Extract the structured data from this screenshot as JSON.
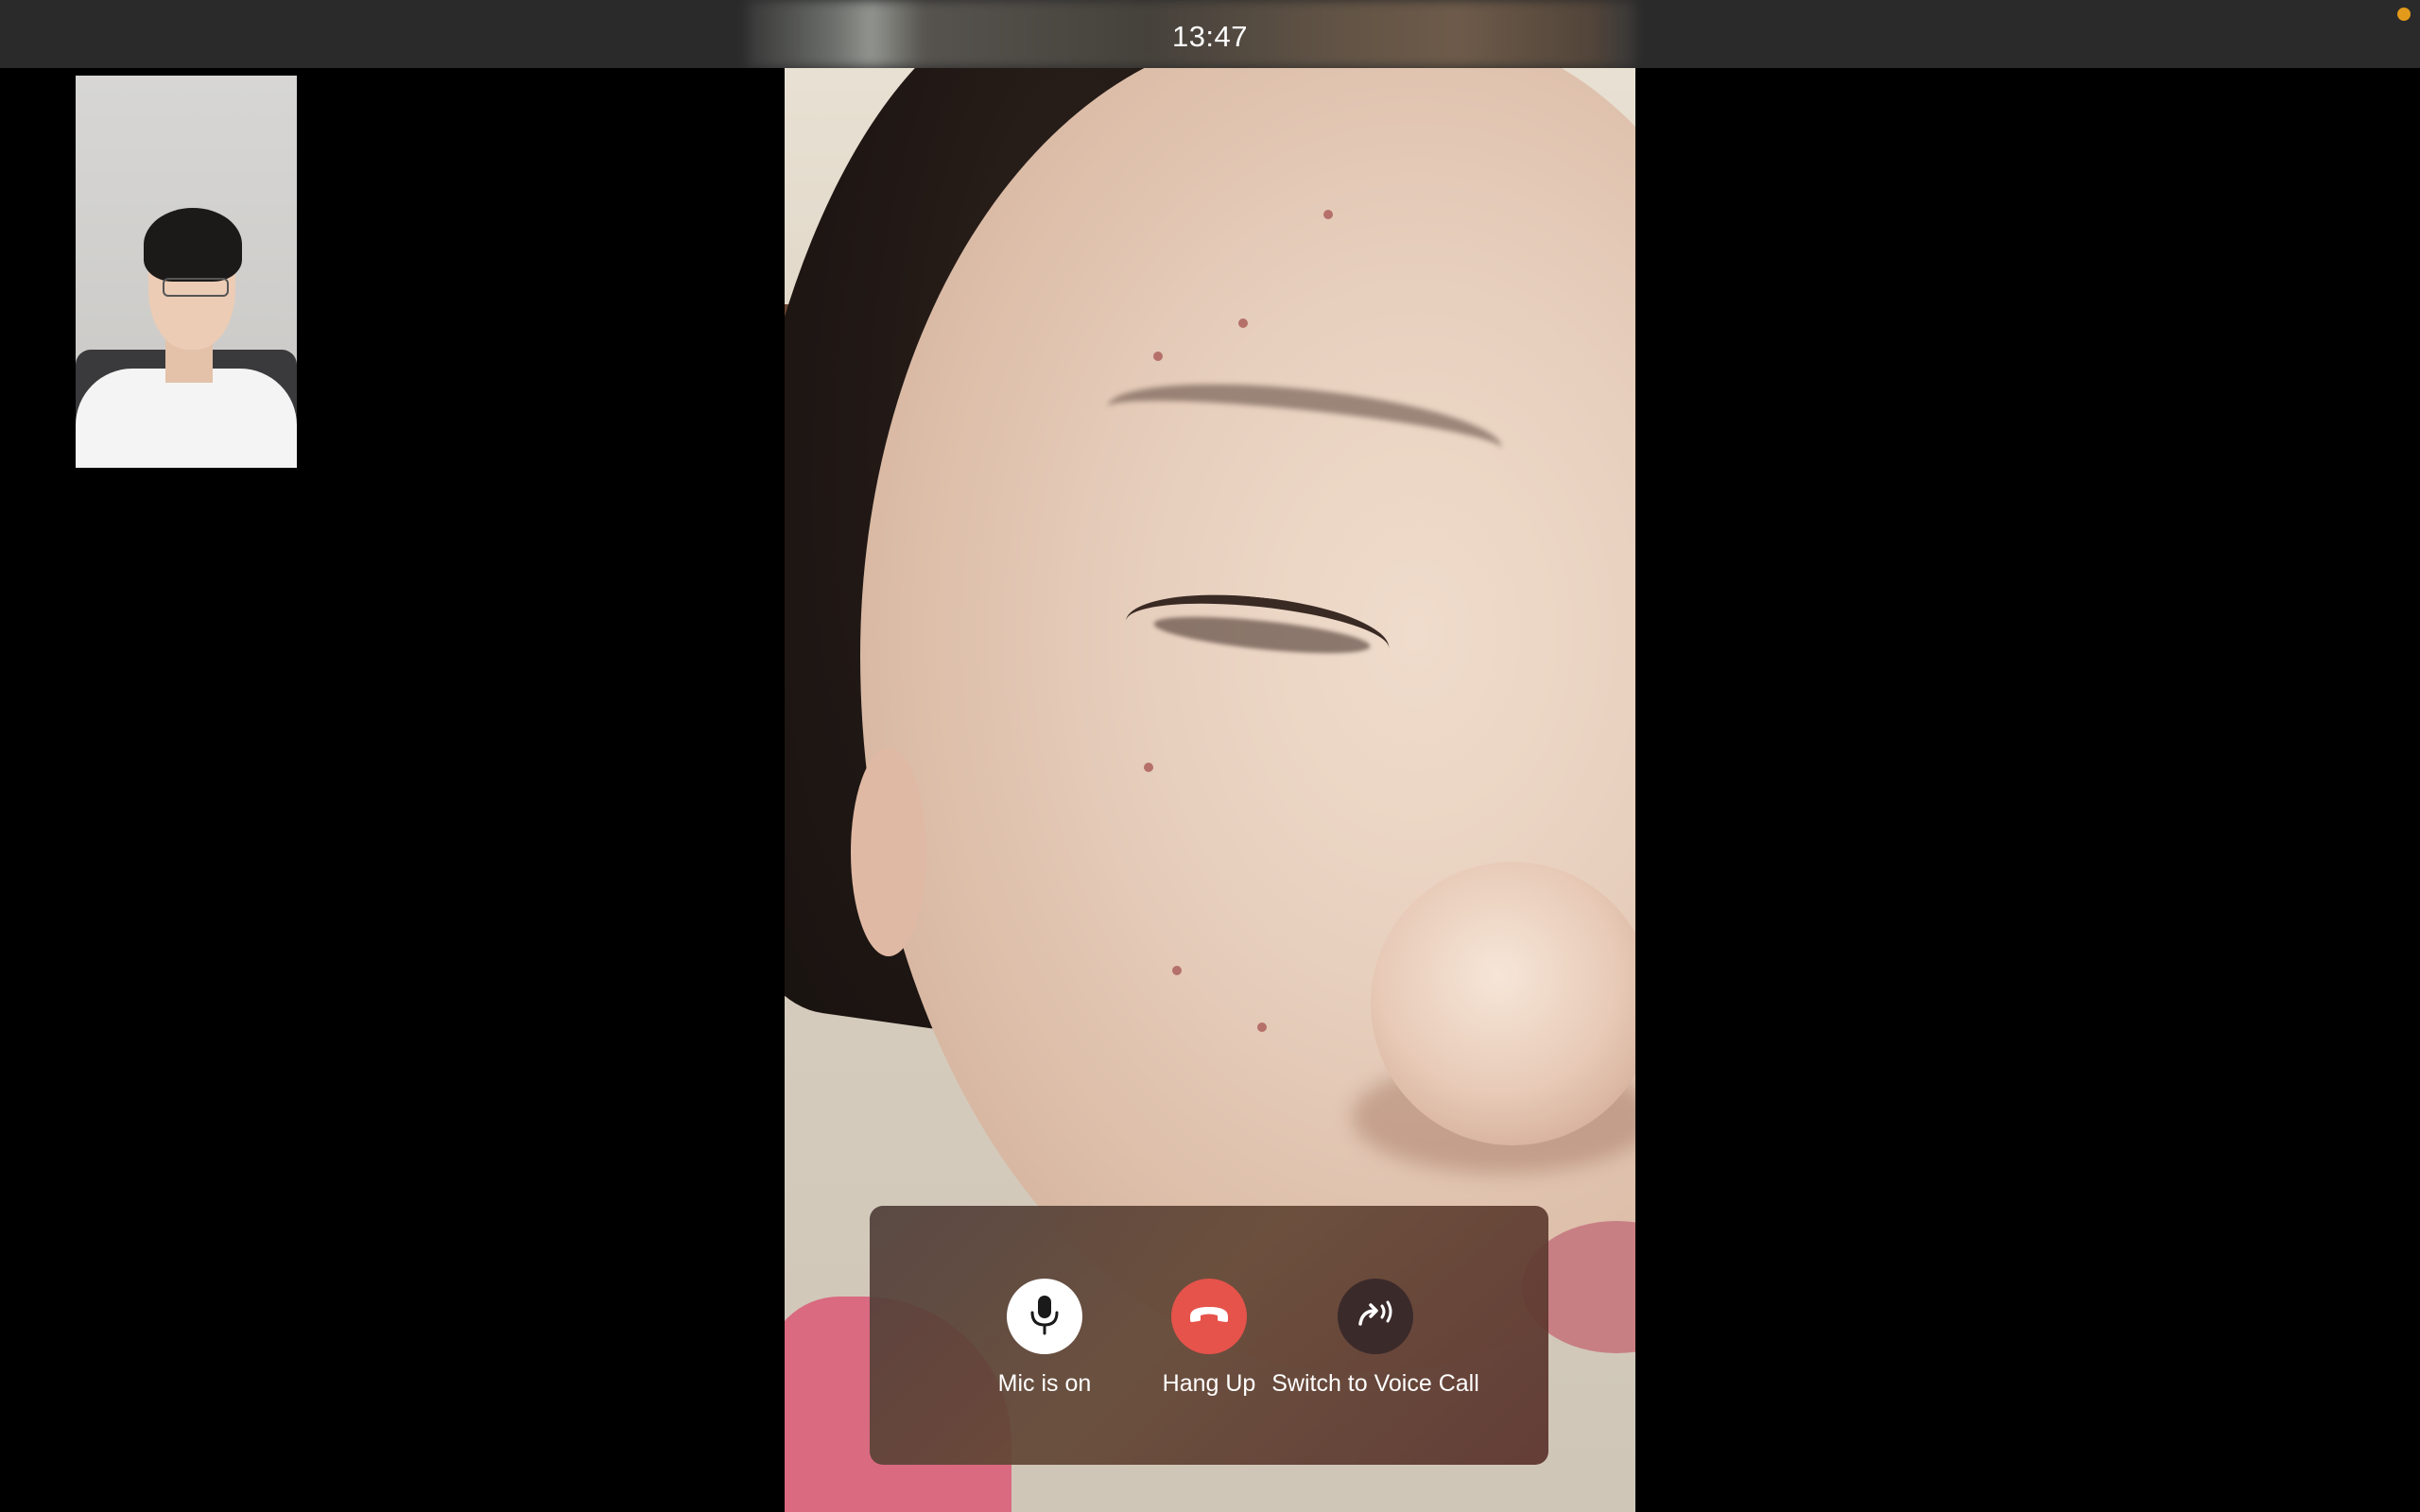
{
  "titlebar": {
    "time": "13:47"
  },
  "status_indicator": {
    "color": "#e39a1a"
  },
  "remote_video": {
    "description_icon": "person-video-feed"
  },
  "self_view": {
    "description_icon": "self-camera-preview"
  },
  "controls": {
    "mic": {
      "label": "Mic is on",
      "icon": "microphone-icon"
    },
    "hangup": {
      "label": "Hang Up",
      "icon": "phone-hangup-icon",
      "color": "#e5534b"
    },
    "voice": {
      "label": "Switch to Voice Call",
      "icon": "voice-call-switch-icon"
    }
  }
}
